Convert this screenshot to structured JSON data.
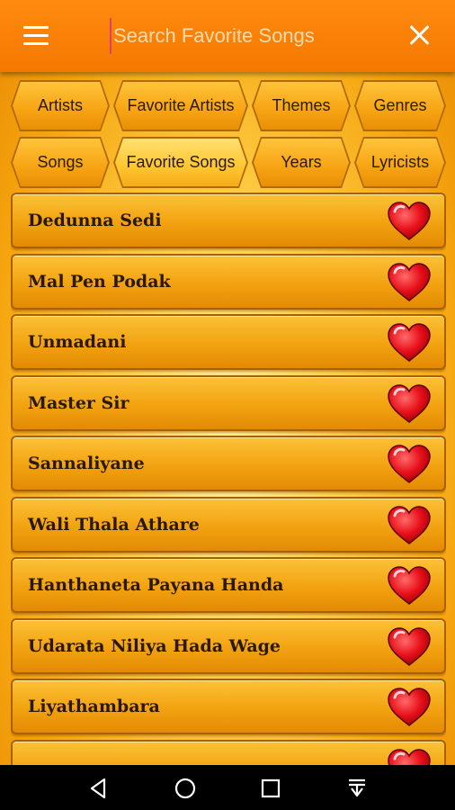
{
  "header": {
    "menu_icon": "hamburger-menu-icon",
    "search_placeholder": "Search Favorite Songs",
    "search_value": "",
    "close_icon": "close-icon"
  },
  "tabs": {
    "row1": [
      "Artists",
      "Favorite Artists",
      "Themes",
      "Genres"
    ],
    "row2": [
      "Songs",
      "Favorite Songs",
      "Years",
      "Lyricists"
    ],
    "active": "Favorite Songs"
  },
  "songs": [
    "Dedunna Sedi",
    "Mal Pen Podak",
    "Unmadani",
    "Master Sir",
    "Sannaliyane",
    "Wali Thala Athare",
    "Hanthaneta Payana Handa",
    "Udarata Niliya Hada Wage",
    "Liyathambara"
  ],
  "favorite_icon": "heart-icon",
  "colors": {
    "header": "#f57800",
    "heart": "#e8101a",
    "item": "#f2a210"
  },
  "navbar": [
    "back-icon",
    "home-icon",
    "recents-icon",
    "notifications-icon"
  ]
}
